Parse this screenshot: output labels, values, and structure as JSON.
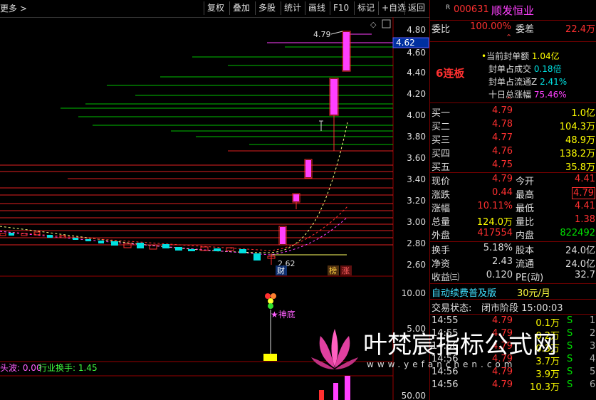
{
  "topbar": {
    "more_label": "更多 >",
    "buttons": [
      "复权",
      "叠加",
      "多股",
      "统计",
      "画线",
      "F10",
      "标记",
      "+自选",
      "返回"
    ]
  },
  "chart": {
    "price_axis": [
      "4.80",
      "4.60",
      "4.40",
      "4.20",
      "4.00",
      "3.80",
      "3.60",
      "3.40",
      "3.20",
      "3.00",
      "2.80",
      "2.60"
    ],
    "vol_axis": [
      "10.00",
      "5.00"
    ],
    "vol_axis_bottom": "50.00",
    "current_price_tag": "4.62",
    "high_label": "4.79",
    "low_label": "2.62",
    "tag_cai": "财",
    "tag_bang": "榜",
    "tag_zhang": "涨",
    "shendi_label": "★神底",
    "indicator_text_1": "头波: 0.00",
    "indicator_text_2": "行业换手: 1.45",
    "window_icons": [
      "◇",
      "□"
    ]
  },
  "header": {
    "r_mark": "R",
    "code": "000631",
    "name": "顺发恒业",
    "weibi_label": "委比",
    "weibi_value": "100.00%",
    "weicha_label": "委差",
    "weicha_value": "22.4万"
  },
  "limit_info": {
    "lianban": "6连板",
    "rows": [
      {
        "label": "当前封单额",
        "value": "1.04亿"
      },
      {
        "label": "封单占成交",
        "value": "0.18倍"
      },
      {
        "label": "封单占流通Z",
        "value": "2.41%"
      },
      {
        "label": "十日总涨幅",
        "value": "75.46%"
      }
    ]
  },
  "bids": [
    {
      "label": "买一",
      "price": "4.79",
      "vol": "1.0亿"
    },
    {
      "label": "买二",
      "price": "4.78",
      "vol": "104.3万"
    },
    {
      "label": "买三",
      "price": "4.77",
      "vol": "48.9万"
    },
    {
      "label": "买四",
      "price": "4.76",
      "vol": "138.2万"
    },
    {
      "label": "买五",
      "price": "4.75",
      "vol": "35.8万"
    }
  ],
  "quote": {
    "xianjia_l": "现价",
    "xianjia_v": "4.79",
    "jinkai_l": "今开",
    "jinkai_v": "4.41",
    "zhangdie_l": "涨跌",
    "zhangdie_v": "0.44",
    "zuigao_l": "最高",
    "zuigao_v": "4.79",
    "zhangfu_l": "涨幅",
    "zhangfu_v": "10.11%",
    "zuidi_l": "最低",
    "zuidi_v": "4.41",
    "zongliang_l": "总量",
    "zongliang_v": "124.0万",
    "liangbi_l": "量比",
    "liangbi_v": "1.38",
    "waipan_l": "外盘",
    "waipan_v": "417554",
    "neipan_l": "内盘",
    "neipan_v": "822492",
    "huanshou_l": "换手",
    "huanshou_v": "5.18%",
    "guben_l": "股本",
    "guben_v": "24.0亿",
    "jingzi_l": "净资",
    "jingzi_v": "2.43",
    "liutong_l": "流通",
    "liutong_v": "24.0亿",
    "shouyi_l": "收益㈢",
    "shouyi_v": "0.120",
    "pe_l": "PE(动)",
    "pe_v": "32.7"
  },
  "promo": {
    "text": "自动续费普及版",
    "price": "30元/月"
  },
  "status": {
    "label": "交易状态:",
    "value": "闭市阶段 15:00:03"
  },
  "trades": [
    {
      "time": "14:55",
      "price": "4.79",
      "vol": "0.1万",
      "dir": "S",
      "n": "1"
    },
    {
      "time": "14:55",
      "price": "4.79",
      "vol": "0.2万",
      "dir": "S",
      "n": "2"
    },
    {
      "time": "14:56",
      "price": "4.79",
      "vol": "0.3万",
      "dir": "S",
      "n": "3"
    },
    {
      "time": "14:56",
      "price": "4.79",
      "vol": "3.7万",
      "dir": "S",
      "n": "4"
    },
    {
      "time": "14:56",
      "price": "4.79",
      "vol": "3.9万",
      "dir": "S",
      "n": "5"
    },
    {
      "time": "14:56",
      "price": "4.79",
      "vol": "10.3万",
      "dir": "S",
      "n": "6"
    }
  ],
  "watermark": {
    "title": "叶梵宸指标公式网",
    "url": "www.yefanchen.com"
  }
}
